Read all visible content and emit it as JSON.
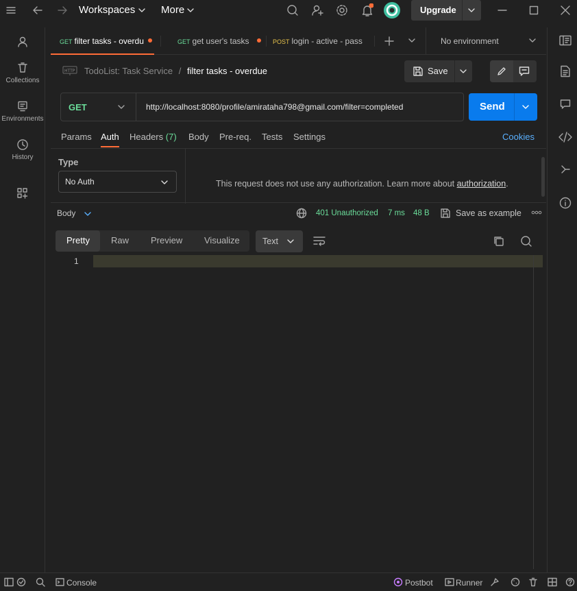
{
  "topbar": {
    "workspaces_label": "Workspaces",
    "more_label": "More",
    "upgrade_label": "Upgrade"
  },
  "sidebar": {
    "items": [
      {
        "label": "Collections"
      },
      {
        "label": "Environments"
      },
      {
        "label": "History"
      }
    ]
  },
  "tabs": [
    {
      "method": "GET",
      "name": "filter tasks - overdu"
    },
    {
      "method": "GET",
      "name": "get user's tasks"
    },
    {
      "method": "POST",
      "name": "login - active - pass"
    }
  ],
  "environment": {
    "selected": "No environment"
  },
  "breadcrumb": {
    "collection": "TodoList: Task Service",
    "separator": "/",
    "request": "filter tasks - overdue"
  },
  "save_label": "Save",
  "request": {
    "method": "GET",
    "url": "http://localhost:8080/profile/amirataha798@gmail.com/filter=completed",
    "send_label": "Send"
  },
  "request_tabs": {
    "params": "Params",
    "auth": "Auth",
    "headers": "Headers",
    "headers_count": "(7)",
    "body": "Body",
    "prereq": "Pre-req.",
    "tests": "Tests",
    "settings": "Settings",
    "cookies": "Cookies"
  },
  "auth": {
    "type_label": "Type",
    "type_value": "No Auth",
    "message": "This request does not use any authorization. Learn more about ",
    "link": "authorization",
    "period": "."
  },
  "response": {
    "body_label": "Body",
    "status": "401 Unauthorized",
    "time": "7 ms",
    "size": "48 B",
    "save_example": "Save as example",
    "view_tabs": [
      "Pretty",
      "Raw",
      "Preview",
      "Visualize"
    ],
    "format": "Text",
    "line_number": "1"
  },
  "statusbar": {
    "console": "Console",
    "postbot": "Postbot",
    "runner": "Runner"
  },
  "colors": {
    "accent": "#ff6c37",
    "send_blue": "#097bed",
    "status_green": "#6bdd9a",
    "link_blue": "#5ab0ff"
  }
}
